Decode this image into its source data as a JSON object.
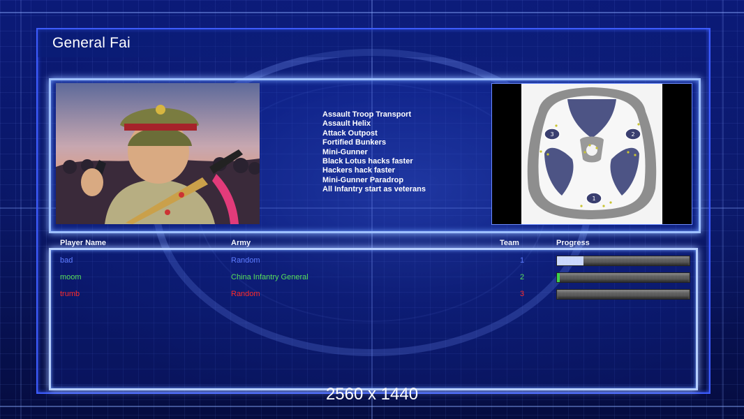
{
  "window": {
    "title": "General Fai"
  },
  "general": {
    "portrait_icon": "general-portrait",
    "traits": [
      "Assault Troop Transport",
      "Assault Helix",
      "Attack Outpost",
      "Fortified Bunkers",
      "Mini-Gunner",
      "Black Lotus hacks faster",
      "Hackers hack faster",
      "Mini-Gunner Paradrop",
      "All Infantry start as veterans"
    ]
  },
  "map": {
    "start_positions": [
      "1",
      "2",
      "3"
    ]
  },
  "players_table": {
    "headers": {
      "name": "Player Name",
      "army": "Army",
      "team": "Team",
      "progress": "Progress"
    },
    "rows": [
      {
        "name": "bad",
        "army": "Random",
        "team": "1",
        "progress": 0.2,
        "color": "#5e7cff"
      },
      {
        "name": "moom",
        "army": "China Infantry General",
        "team": "2",
        "progress": 0.02,
        "color": "#57e05a"
      },
      {
        "name": "trumb",
        "army": "Random",
        "team": "3",
        "progress": 0.0,
        "color": "#ff2b2b"
      }
    ]
  },
  "resolution_label": "2560 x 1440",
  "colors": {
    "frame": "#3d5cff",
    "panel_border": "#9ec0ff"
  }
}
